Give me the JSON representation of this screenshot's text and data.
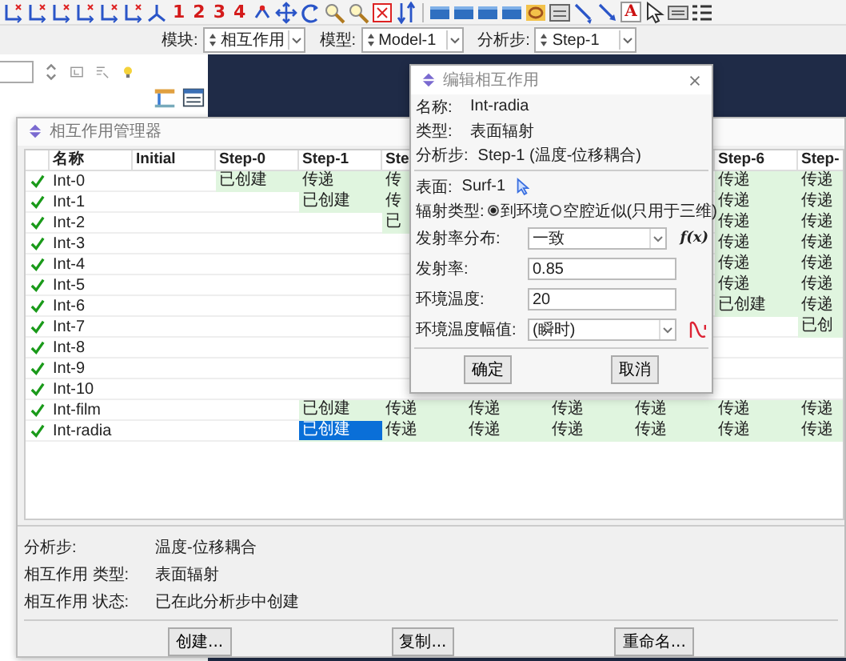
{
  "toolbar": {
    "numbers": [
      "1",
      "2",
      "3",
      "4"
    ],
    "letter": "A"
  },
  "context_bar": [
    {
      "label": "模块:",
      "value": "相互作用"
    },
    {
      "label": "模型:",
      "value": "Model-1"
    },
    {
      "label": "分析步:",
      "value": "Step-1"
    }
  ],
  "manager": {
    "title": "相互作用管理器",
    "columns": [
      "名称",
      "Initial",
      "Step-0",
      "Step-1",
      "Ste",
      null,
      null,
      null,
      "Step-6",
      "Step-"
    ],
    "rows": [
      {
        "active": true,
        "cells": [
          "Int-0",
          "",
          {
            "text": "已创建",
            "selected": false
          },
          {
            "text": "传递",
            "selected": false
          },
          {
            "text": "传",
            "selected": false
          },
          null,
          null,
          null,
          {
            "text": "传递",
            "selected": false
          },
          {
            "text": "传递",
            "selected": false
          }
        ]
      },
      {
        "active": true,
        "cells": [
          "Int-1",
          "",
          "",
          {
            "text": "已创建",
            "selected": false
          },
          {
            "text": "传",
            "selected": false
          },
          null,
          null,
          null,
          {
            "text": "传递",
            "selected": false
          },
          {
            "text": "传递",
            "selected": false
          }
        ]
      },
      {
        "active": true,
        "cells": [
          "Int-2",
          "",
          "",
          "",
          {
            "text": "已",
            "selected": false
          },
          null,
          null,
          null,
          {
            "text": "传递",
            "selected": false
          },
          {
            "text": "传递",
            "selected": false
          }
        ]
      },
      {
        "active": true,
        "cells": [
          "Int-3",
          "",
          "",
          "",
          "",
          null,
          null,
          null,
          {
            "text": "传递",
            "selected": false
          },
          {
            "text": "传递",
            "selected": false
          }
        ]
      },
      {
        "active": true,
        "cells": [
          "Int-4",
          "",
          "",
          "",
          "",
          null,
          null,
          null,
          {
            "text": "传递",
            "selected": false
          },
          {
            "text": "传递",
            "selected": false
          }
        ]
      },
      {
        "active": true,
        "cells": [
          "Int-5",
          "",
          "",
          "",
          "",
          null,
          null,
          null,
          {
            "text": "传递",
            "selected": false
          },
          {
            "text": "传递",
            "selected": false
          }
        ]
      },
      {
        "active": true,
        "cells": [
          "Int-6",
          "",
          "",
          "",
          "",
          null,
          null,
          null,
          {
            "text": "已创建",
            "selected": false
          },
          {
            "text": "传递",
            "selected": false
          }
        ]
      },
      {
        "active": true,
        "cells": [
          "Int-7",
          "",
          "",
          "",
          "",
          null,
          null,
          null,
          "",
          {
            "text": "已创",
            "selected": false
          }
        ]
      },
      {
        "active": true,
        "cells": [
          "Int-8",
          "",
          "",
          "",
          "",
          null,
          null,
          null,
          "",
          ""
        ]
      },
      {
        "active": true,
        "cells": [
          "Int-9",
          "",
          "",
          "",
          "",
          null,
          null,
          null,
          "",
          ""
        ]
      },
      {
        "active": true,
        "cells": [
          "Int-10",
          "",
          "",
          "",
          "",
          null,
          null,
          null,
          "",
          ""
        ]
      },
      {
        "active": true,
        "cells": [
          "Int-film",
          "",
          "",
          {
            "text": "已创建",
            "selected": false
          },
          {
            "text": "传递",
            "selected": false
          },
          {
            "text": "传递",
            "selected": false
          },
          {
            "text": "传递",
            "selected": false
          },
          {
            "text": "传递",
            "selected": false
          },
          {
            "text": "传递",
            "selected": false
          },
          {
            "text": "传递",
            "selected": false
          }
        ]
      },
      {
        "active": true,
        "cells": [
          "Int-radia",
          "",
          "",
          {
            "text": "已创建",
            "selected": true
          },
          {
            "text": "传递",
            "selected": false
          },
          {
            "text": "传递",
            "selected": false
          },
          {
            "text": "传递",
            "selected": false
          },
          {
            "text": "传递",
            "selected": false
          },
          {
            "text": "传递",
            "selected": false
          },
          {
            "text": "传递",
            "selected": false
          }
        ]
      }
    ],
    "info": [
      {
        "label": "分析步:",
        "value": "温度-位移耦合"
      },
      {
        "label": "相互作用 类型:",
        "value": "表面辐射"
      },
      {
        "label": "相互作用 状态:",
        "value": "已在此分析步中创建"
      }
    ],
    "buttons": [
      "创建...",
      "复制...",
      "重命名..."
    ]
  },
  "dialog": {
    "title": "编辑相互作用",
    "summary": [
      {
        "label": "名称:",
        "value": "Int-radia"
      },
      {
        "label": "类型:",
        "value": "表面辐射"
      },
      {
        "label": "分析步:",
        "value": "Step-1 (温度-位移耦合)"
      }
    ],
    "surface": {
      "label": "表面:",
      "value": "Surf-1"
    },
    "radiation_type": {
      "label": "辐射类型:",
      "options": [
        {
          "label": "到环境",
          "selected": true
        },
        {
          "label": "空腔近似(只用于三维)",
          "selected": false
        }
      ]
    },
    "fields": [
      {
        "kind": "function",
        "label": "发射率分布:",
        "value": "一致",
        "side": "f(x)"
      },
      {
        "kind": "text",
        "label": "发射率:",
        "value": "0.85"
      },
      {
        "kind": "text",
        "label": "环境温度:",
        "value": "20"
      },
      {
        "kind": "amplitude",
        "label": "环境温度幅值:",
        "value": "(瞬时)"
      }
    ],
    "buttons": [
      "确定",
      "取消"
    ]
  }
}
